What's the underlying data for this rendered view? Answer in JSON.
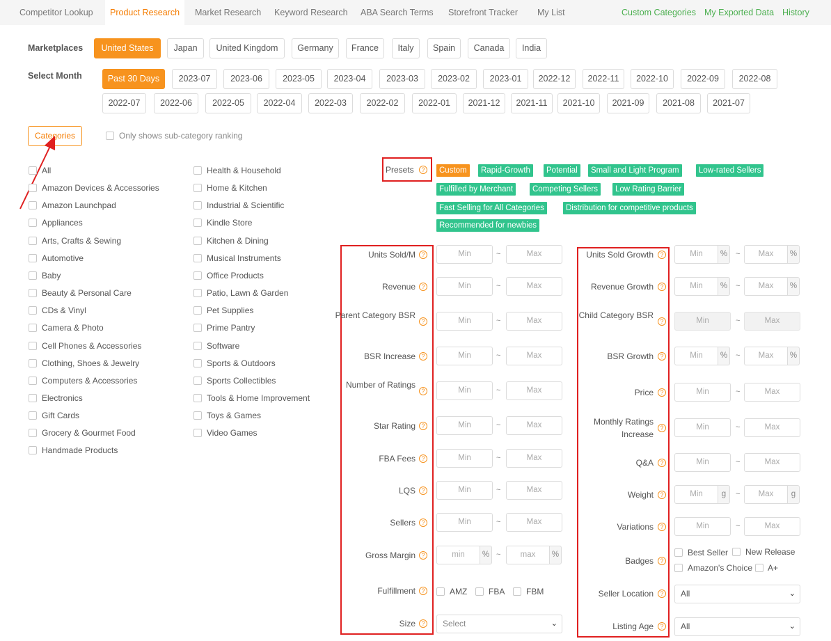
{
  "tabs": [
    "Competitor Lookup",
    "Product Research",
    "Market Research",
    "Keyword Research",
    "ABA Search Terms",
    "Storefront Tracker",
    "My List"
  ],
  "right_links": [
    "Custom Categories",
    "My Exported Data",
    "History"
  ],
  "marketplaces": {
    "label": "Marketplaces",
    "options": [
      "United States",
      "Japan",
      "United Kingdom",
      "Germany",
      "France",
      "Italy",
      "Spain",
      "Canada",
      "India"
    ],
    "selected": "United States"
  },
  "months": {
    "label": "Select Month",
    "row1": [
      "Past 30 Days",
      "2023-07",
      "2023-06",
      "2023-05",
      "2023-04",
      "2023-03",
      "2023-02",
      "2023-01",
      "2022-12",
      "2022-11",
      "2022-10",
      "2022-09",
      "2022-08"
    ],
    "row2": [
      "2022-07",
      "2022-06",
      "2022-05",
      "2022-04",
      "2022-03",
      "2022-02",
      "2022-01",
      "2021-12",
      "2021-11",
      "2021-10",
      "2021-09",
      "2021-08",
      "2021-07"
    ],
    "selected": "Past 30 Days"
  },
  "categories_button": "Categories",
  "subcat_toggle": "Only shows sub-category ranking",
  "categories_col1": [
    "All",
    "Amazon Devices & Accessories",
    "Amazon Launchpad",
    "Appliances",
    "Arts, Crafts & Sewing",
    "Automotive",
    "Baby",
    "Beauty & Personal Care",
    "CDs & Vinyl",
    "Camera & Photo",
    "Cell Phones & Accessories",
    "Clothing, Shoes & Jewelry",
    "Computers & Accessories",
    "Electronics",
    "Gift Cards",
    "Grocery & Gourmet Food",
    "Handmade Products"
  ],
  "categories_col2": [
    "Health & Household",
    "Home & Kitchen",
    "Industrial & Scientific",
    "Kindle Store",
    "Kitchen & Dining",
    "Musical Instruments",
    "Office Products",
    "Patio, Lawn & Garden",
    "Pet Supplies",
    "Prime Pantry",
    "Software",
    "Sports & Outdoors",
    "Sports Collectibles",
    "Tools & Home Improvement",
    "Toys & Games",
    "Video Games"
  ],
  "presets": {
    "label": "Presets",
    "items": [
      "Custom",
      "Rapid-Growth",
      "Potential",
      "Small and Light Program",
      "Low-rated Sellers",
      "Fulfilled by Merchant",
      "Competing Sellers",
      "Low Rating Barrier",
      "Fast Selling for All Categories",
      "Distribution for competitive products",
      "Recommended for newbies"
    ],
    "selected": "Custom"
  },
  "filters_left": [
    {
      "label": "Units Sold/M",
      "min": "Min",
      "max": "Max"
    },
    {
      "label": "Revenue",
      "min": "Min",
      "max": "Max"
    },
    {
      "label": "Parent Category BSR",
      "min": "Min",
      "max": "Max"
    },
    {
      "label": "BSR Increase",
      "min": "Min",
      "max": "Max"
    },
    {
      "label": "Number of Ratings",
      "min": "Min",
      "max": "Max"
    },
    {
      "label": "Star Rating",
      "min": "Min",
      "max": "Max"
    },
    {
      "label": "FBA Fees",
      "min": "Min",
      "max": "Max"
    },
    {
      "label": "LQS",
      "min": "Min",
      "max": "Max"
    },
    {
      "label": "Sellers",
      "min": "Min",
      "max": "Max"
    },
    {
      "label": "Gross Margin",
      "min": "min",
      "max": "max",
      "unit": "%"
    }
  ],
  "fulfillment": {
    "label": "Fulfillment",
    "options": [
      "AMZ",
      "FBA",
      "FBM"
    ]
  },
  "size": {
    "label": "Size",
    "value": "Select"
  },
  "filters_right": [
    {
      "label": "Units Sold Growth",
      "min": "Min",
      "max": "Max",
      "unit": "%"
    },
    {
      "label": "Revenue Growth",
      "min": "Min",
      "max": "Max",
      "unit": "%"
    },
    {
      "label": "Child Category BSR",
      "min": "Min",
      "max": "Max"
    },
    {
      "label": "BSR Growth",
      "min": "Min",
      "max": "Max",
      "unit": "%"
    },
    {
      "label": "Price",
      "min": "Min",
      "max": "Max"
    },
    {
      "label": "Monthly Ratings Increase",
      "min": "Min",
      "max": "Max"
    },
    {
      "label": "Q&A",
      "min": "Min",
      "max": "Max"
    },
    {
      "label": "Weight",
      "min": "Min",
      "max": "Max",
      "unit": "g"
    },
    {
      "label": "Variations",
      "min": "Min",
      "max": "Max"
    }
  ],
  "badges": {
    "label": "Badges",
    "options": [
      "Best Seller",
      "New Release",
      "Amazon's Choice",
      "A+"
    ]
  },
  "seller_location": {
    "label": "Seller Location",
    "value": "All"
  },
  "listing_age": {
    "label": "Listing Age",
    "value": "All"
  },
  "help_glyph": "?",
  "range_sep": "~",
  "dropdown_glyph": "⌄",
  "colors": {
    "accent": "#f7931e",
    "preset_green": "#31c48d",
    "link_green": "#4caf50",
    "highlight_red": "#e02020"
  }
}
